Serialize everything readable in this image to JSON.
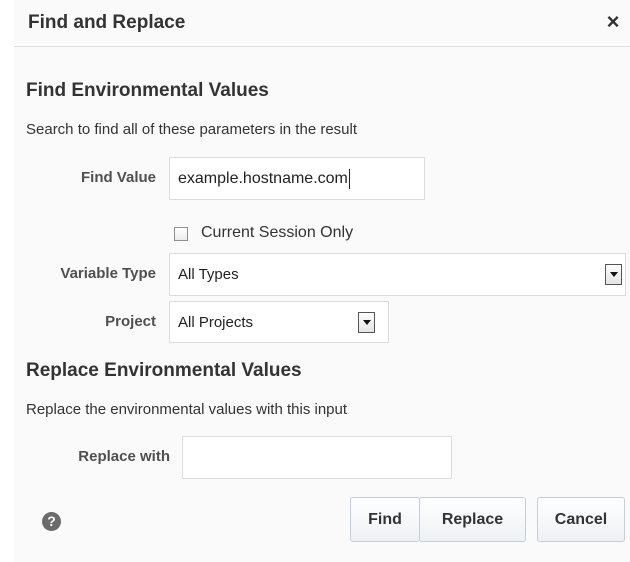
{
  "dialog": {
    "title": "Find and Replace",
    "close_glyph": "×"
  },
  "find_section": {
    "heading": "Find Environmental Values",
    "description": "Search to find all of these parameters in the result",
    "find_value_label": "Find Value",
    "find_value": "example.hostname.com",
    "current_session_label": "Current Session Only",
    "current_session_checked": false,
    "variable_type_label": "Variable Type",
    "variable_type_value": "All Types",
    "project_label": "Project",
    "project_value": "All Projects"
  },
  "replace_section": {
    "heading": "Replace Environmental Values",
    "description": "Replace the environmental values with this input",
    "replace_with_label": "Replace with",
    "replace_with_value": ""
  },
  "footer": {
    "help_glyph": "?",
    "find_label": "Find",
    "replace_label": "Replace",
    "cancel_label": "Cancel"
  },
  "icons": {
    "close": "close-icon",
    "help": "help-icon",
    "dropdown": "chevron-down-icon"
  }
}
